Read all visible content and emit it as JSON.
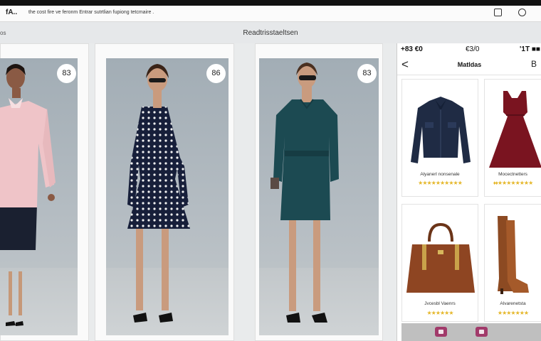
{
  "topbar": {
    "brand": "fA..",
    "ticker": "the cost fire ve feronm   Entrar sutrtlian   fupiong tetcmaire  ."
  },
  "subbar": {
    "left": "os",
    "title": "Readtrisstaeltsen"
  },
  "cards": [
    {
      "price": "83",
      "outfit": "pink coat"
    },
    {
      "price": "86",
      "outfit": "polka-dot dress"
    },
    {
      "price": "83",
      "outfit": "green shirt dress"
    }
  ],
  "phone": {
    "status": {
      "time": "+83 €0",
      "middle": "€3/0",
      "right": "'1T ■■"
    },
    "nav": {
      "back": "<",
      "title": "Matldas",
      "bag": "B"
    },
    "products": [
      {
        "name": "Alyanerl nonsenale",
        "stars": "★★★★★★★★★★",
        "item": "denim-jacket"
      },
      {
        "name": "Mocectnetters",
        "stars": "♦♦★★★★★★★★",
        "item": "burgundy-dress"
      },
      {
        "name": "Jvcesbl Vaenrs",
        "stars": "★★★★★★",
        "item": "brown-handbag"
      },
      {
        "name": "Alvarenetsta",
        "stars": "★★★★★★★",
        "item": "knee-boots"
      }
    ]
  },
  "colors": {
    "star": "#e5b72a",
    "tab": "#a13a6a",
    "dark": "#111111"
  }
}
